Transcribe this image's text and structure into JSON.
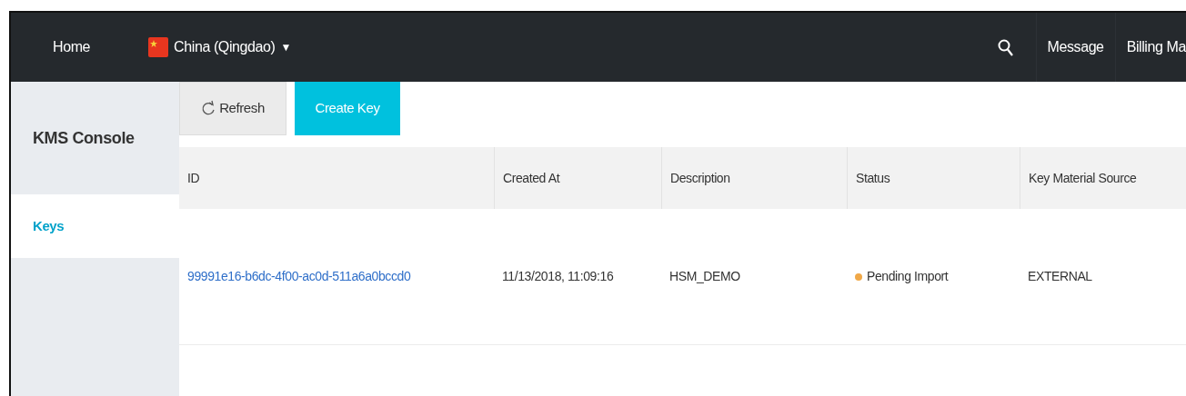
{
  "topbar": {
    "home": "Home",
    "region": {
      "label": "China (Qingdao)",
      "caret": "▼"
    },
    "links": [
      "Message",
      "Billing Ma"
    ]
  },
  "sidebar": {
    "title": "KMS Console",
    "items": [
      {
        "label": "Keys",
        "selected": true
      }
    ]
  },
  "toolbar": {
    "buttons": [
      {
        "label": "Refresh",
        "kind": "refresh"
      },
      {
        "label": "Create Key",
        "kind": "primary"
      }
    ]
  },
  "table": {
    "columns": [
      "ID",
      "Created At",
      "Description",
      "Status",
      "Key Material Source"
    ],
    "rows": [
      {
        "id": "99991e16-b6dc-4f00-ac0d-511a6a0bccd0",
        "created_at": "11/13/2018, 11:09:16",
        "description": "HSM_DEMO",
        "status": {
          "label": "Pending Import",
          "color": "#f0a848"
        },
        "key_material_source": "EXTERNAL"
      }
    ]
  }
}
